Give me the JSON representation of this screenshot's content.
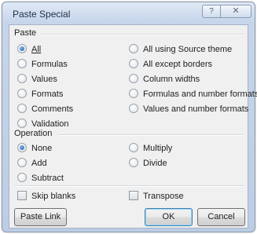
{
  "window": {
    "title": "Paste Special",
    "help_label": "?",
    "close_label": "✕"
  },
  "paste": {
    "label": "Paste",
    "left_options": [
      "All",
      "Formulas",
      "Values",
      "Formats",
      "Comments",
      "Validation"
    ],
    "right_options": [
      "All using Source theme",
      "All except borders",
      "Column widths",
      "Formulas and number formats",
      "Values and number formats"
    ],
    "selected": "All"
  },
  "operation": {
    "label": "Operation",
    "left_options": [
      "None",
      "Add",
      "Subtract"
    ],
    "right_options": [
      "Multiply",
      "Divide"
    ],
    "selected": "None"
  },
  "checkboxes": {
    "skip_blanks": "Skip blanks",
    "transpose": "Transpose"
  },
  "buttons": {
    "paste_link": "Paste Link",
    "ok": "OK",
    "cancel": "Cancel"
  },
  "colors": {
    "accent": "#1d5fa8",
    "frame": "#bccde5",
    "panel": "#f0f0f0"
  }
}
